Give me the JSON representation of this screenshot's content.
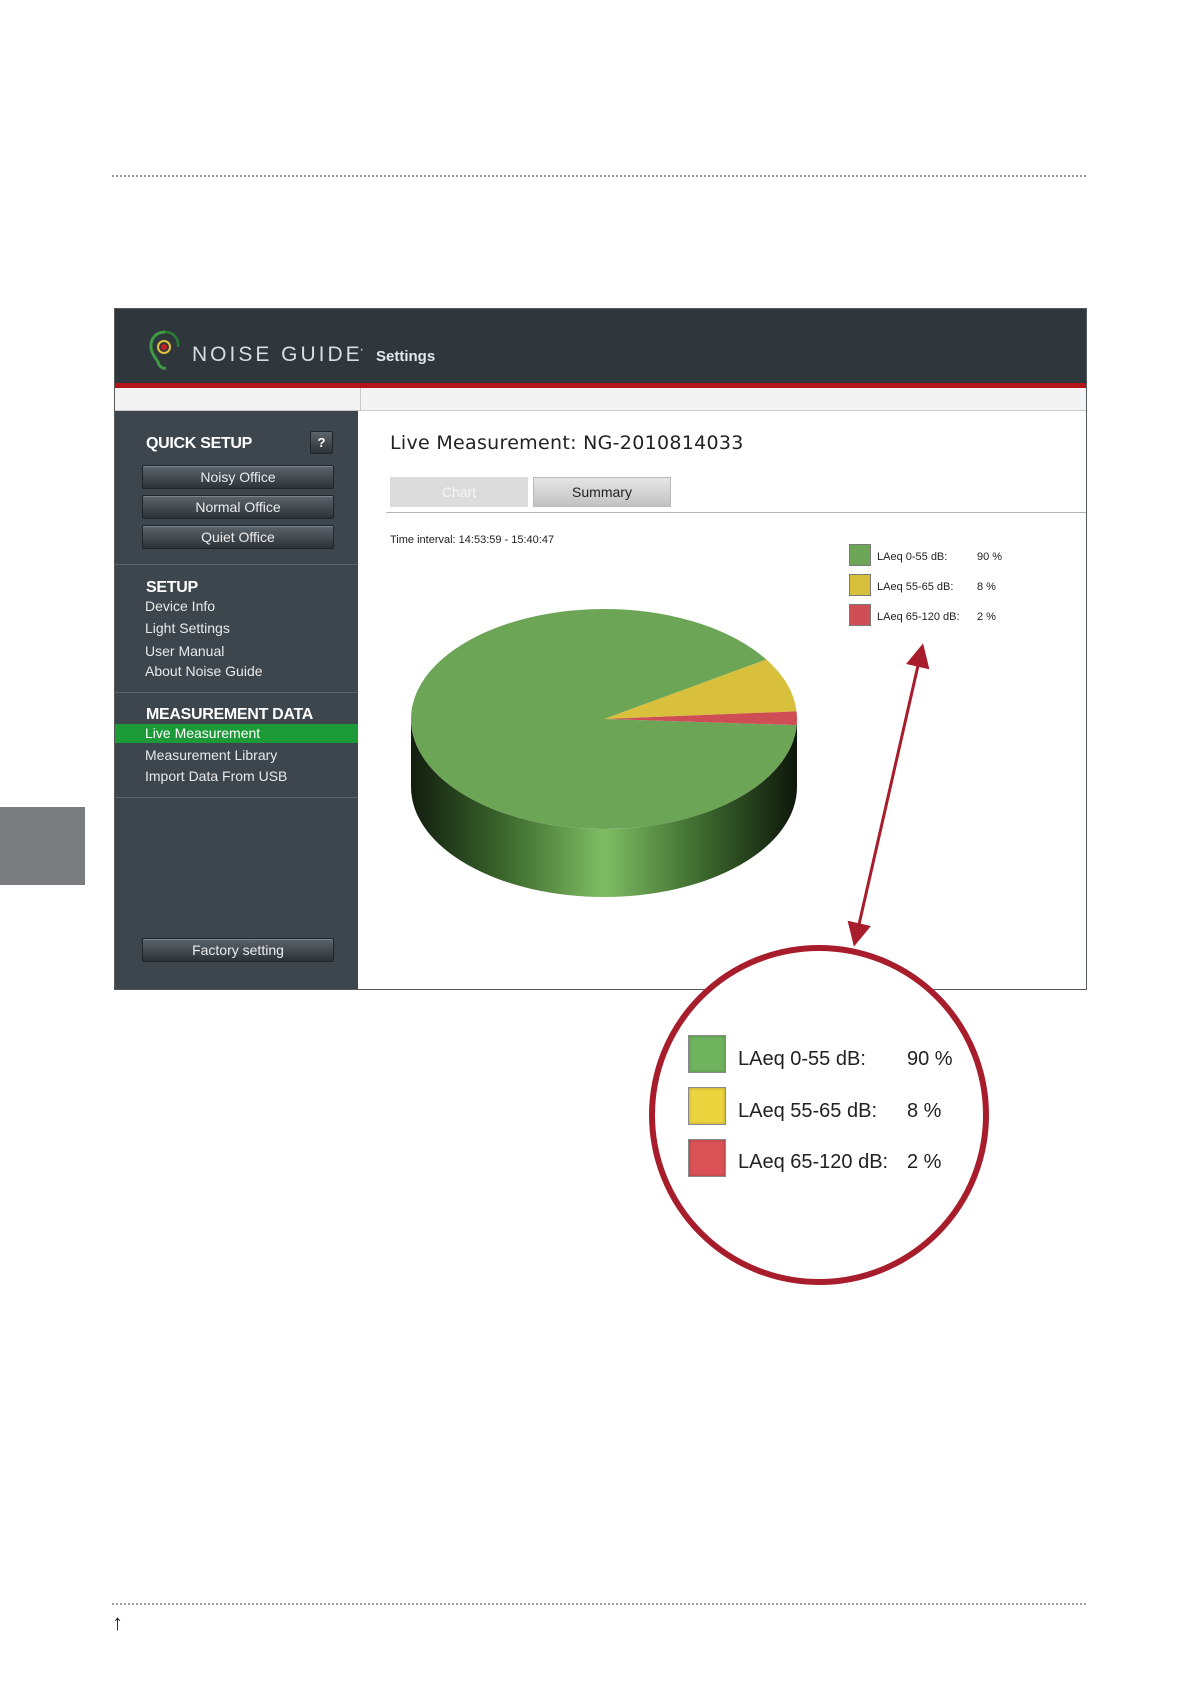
{
  "app": {
    "name": "NOISE GUIDE",
    "separator": "·",
    "section": "Settings"
  },
  "sidebar": {
    "quick_setup": {
      "heading": "QUICK SETUP",
      "help": "?",
      "buttons": [
        "Noisy Office",
        "Normal Office",
        "Quiet Office"
      ]
    },
    "setup": {
      "heading": "SETUP",
      "items": [
        "Device Info",
        "Light Settings",
        "User Manual",
        "About Noise Guide"
      ]
    },
    "measurement_data": {
      "heading": "MEASUREMENT DATA",
      "items": [
        "Live Measurement",
        "Measurement Library",
        "Import Data From USB"
      ],
      "active_index": 0
    },
    "factory_button": "Factory setting"
  },
  "main": {
    "title": "Live Measurement: NG-2010814033",
    "tabs": [
      {
        "label": "Chart",
        "active": false
      },
      {
        "label": "Summary",
        "active": true
      }
    ],
    "time_interval": "Time interval: 14:53:59 - 15:40:47"
  },
  "chart_data": {
    "type": "pie",
    "title": "",
    "labels": [
      "LAeq 0-55 dB:",
      "LAeq 55-65 dB:",
      "LAeq 65-120 dB:"
    ],
    "values": [
      90,
      8,
      2
    ],
    "value_labels": [
      "90 %",
      "8 %",
      "2 %"
    ],
    "colors": [
      "#6ca556",
      "#d8bf3c",
      "#cf4e55"
    ],
    "legend_position": "top-right"
  },
  "zoom_legend": {
    "items": [
      {
        "label": "LAeq 0-55 dB:",
        "value": "90 %",
        "color": "#6fb35f"
      },
      {
        "label": "LAeq 55-65 dB:",
        "value": "8 %",
        "color": "#ecd43f"
      },
      {
        "label": "LAeq 65-120 dB:",
        "value": "2 %",
        "color": "#db5257"
      }
    ]
  },
  "footer": {
    "arrow": "↑"
  },
  "colors": {
    "accent_red": "#b3141c",
    "active_green": "#1c9a37",
    "titlebar": "#2f373d",
    "sidebar": "#3d464c"
  }
}
